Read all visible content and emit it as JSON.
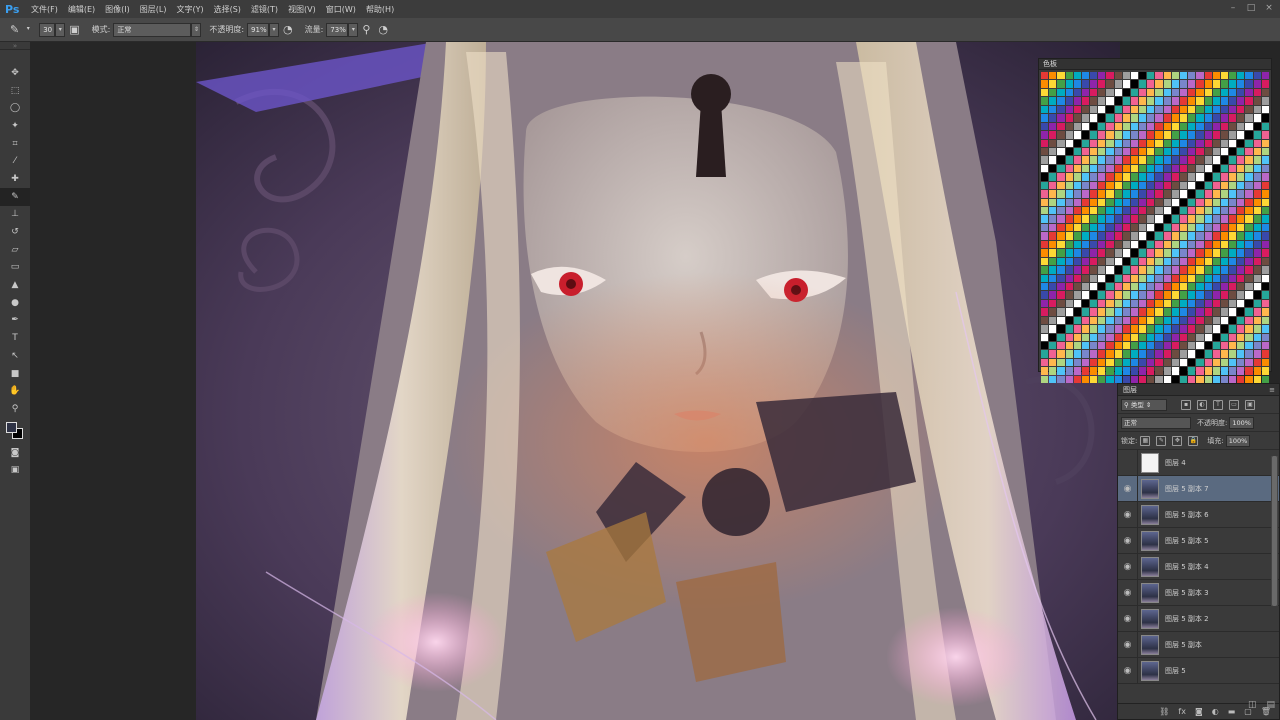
{
  "app": {
    "logo": "Ps"
  },
  "menu": [
    "文件(F)",
    "编辑(E)",
    "图像(I)",
    "图层(L)",
    "文字(Y)",
    "选择(S)",
    "滤镜(T)",
    "视图(V)",
    "窗口(W)",
    "帮助(H)"
  ],
  "options": {
    "brush_size": "30",
    "mode_label": "模式:",
    "mode_value": "正常",
    "opacity_label": "不透明度:",
    "opacity_value": "91%",
    "flow_label": "流量:",
    "flow_value": "73%"
  },
  "swatches_panel": {
    "title": "色板"
  },
  "layers_panel": {
    "title": "图层",
    "filter_label": "类型",
    "blend_mode": "正常",
    "opacity_label": "不透明度:",
    "opacity_value": "100%",
    "lock_label": "锁定:",
    "fill_label": "填充:",
    "fill_value": "100%",
    "layers": [
      {
        "name": "图层 4",
        "visible": false,
        "selected": false,
        "thumb": "white"
      },
      {
        "name": "图层 5 副本 7",
        "visible": true,
        "selected": true,
        "thumb": "art"
      },
      {
        "name": "图层 5 副本 6",
        "visible": true,
        "selected": false,
        "thumb": "art"
      },
      {
        "name": "图层 5 副本 5",
        "visible": true,
        "selected": false,
        "thumb": "art"
      },
      {
        "name": "图层 5 副本 4",
        "visible": true,
        "selected": false,
        "thumb": "art"
      },
      {
        "name": "图层 5 副本 3",
        "visible": true,
        "selected": false,
        "thumb": "art"
      },
      {
        "name": "图层 5 副本 2",
        "visible": true,
        "selected": false,
        "thumb": "art"
      },
      {
        "name": "图层 5 副本",
        "visible": true,
        "selected": false,
        "thumb": "art"
      },
      {
        "name": "图层 5",
        "visible": true,
        "selected": false,
        "thumb": "art"
      }
    ]
  },
  "colors": {
    "foreground": "#2f3346",
    "background": "#000000",
    "selection": "#5a6a80",
    "accent": "#3b9ff0"
  }
}
